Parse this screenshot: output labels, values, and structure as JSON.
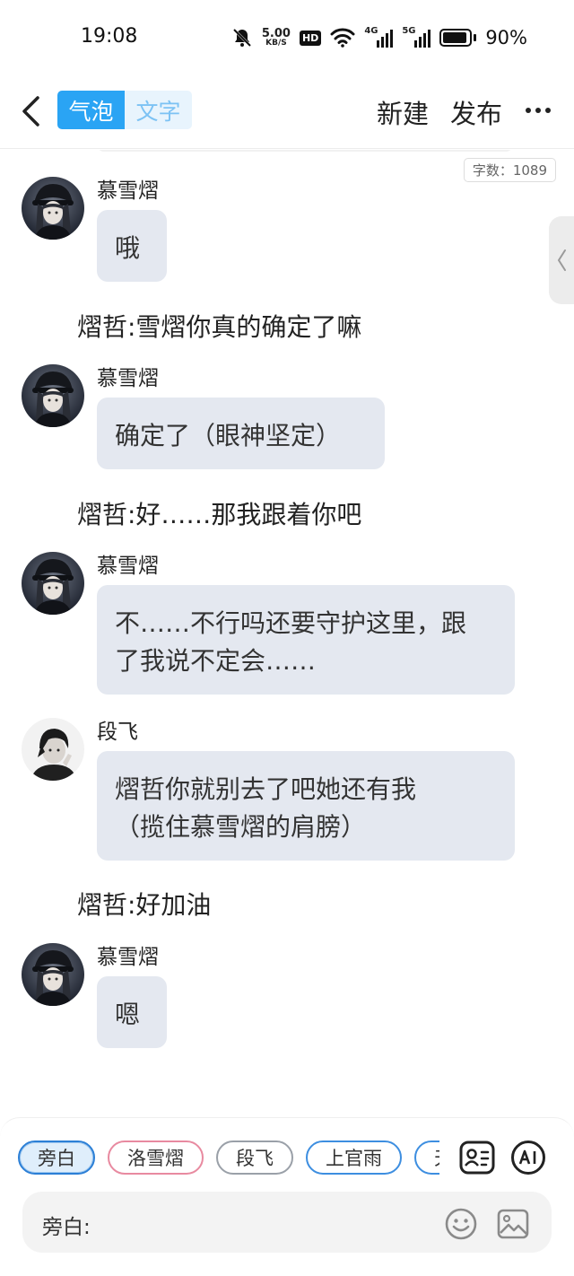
{
  "status_bar": {
    "time": "19:08",
    "net_speed_value": "5.00",
    "net_speed_unit": "KB/S",
    "hd_label": "HD",
    "sig1_label": "4G",
    "sig2_label": "5G",
    "battery_percent": "90%",
    "battery_level": 0.9
  },
  "header": {
    "tabs": [
      {
        "label": "气泡",
        "active": true
      },
      {
        "label": "文字",
        "active": false
      }
    ],
    "new_label": "新建",
    "publish_label": "发布"
  },
  "word_count": "字数：1089",
  "messages": [
    {
      "kind": "bubble",
      "speaker": "慕雪熠",
      "avatar": "girl-cap",
      "text": "哦"
    },
    {
      "kind": "narration",
      "text": "熠哲:雪熠你真的确定了嘛"
    },
    {
      "kind": "bubble",
      "speaker": "慕雪熠",
      "avatar": "girl-cap",
      "text": "确定了（眼神坚定）"
    },
    {
      "kind": "narration",
      "text": "熠哲:好……那我跟着你吧"
    },
    {
      "kind": "bubble",
      "speaker": "慕雪熠",
      "avatar": "girl-cap",
      "text_lines": [
        "不……不行吗还要守护这里，跟",
        "了我说不定会……"
      ]
    },
    {
      "kind": "bubble",
      "speaker": "段飞",
      "avatar": "boy-dark",
      "text_lines": [
        "熠哲你就别去了吧她还有我",
        "（揽住慕雪熠的肩膀）"
      ]
    },
    {
      "kind": "narration",
      "text": "熠哲:好加油"
    },
    {
      "kind": "bubble",
      "speaker": "慕雪熠",
      "avatar": "girl-cap",
      "text": "嗯"
    }
  ],
  "roles": [
    "旁白",
    "洛雪熠",
    "段飞",
    "上官雨",
    "天"
  ],
  "active_role": "旁白",
  "input": {
    "label": "旁白:",
    "value": ""
  },
  "colors": {
    "accent": "#2aa4f4",
    "bubble": "#e4e8f0"
  }
}
